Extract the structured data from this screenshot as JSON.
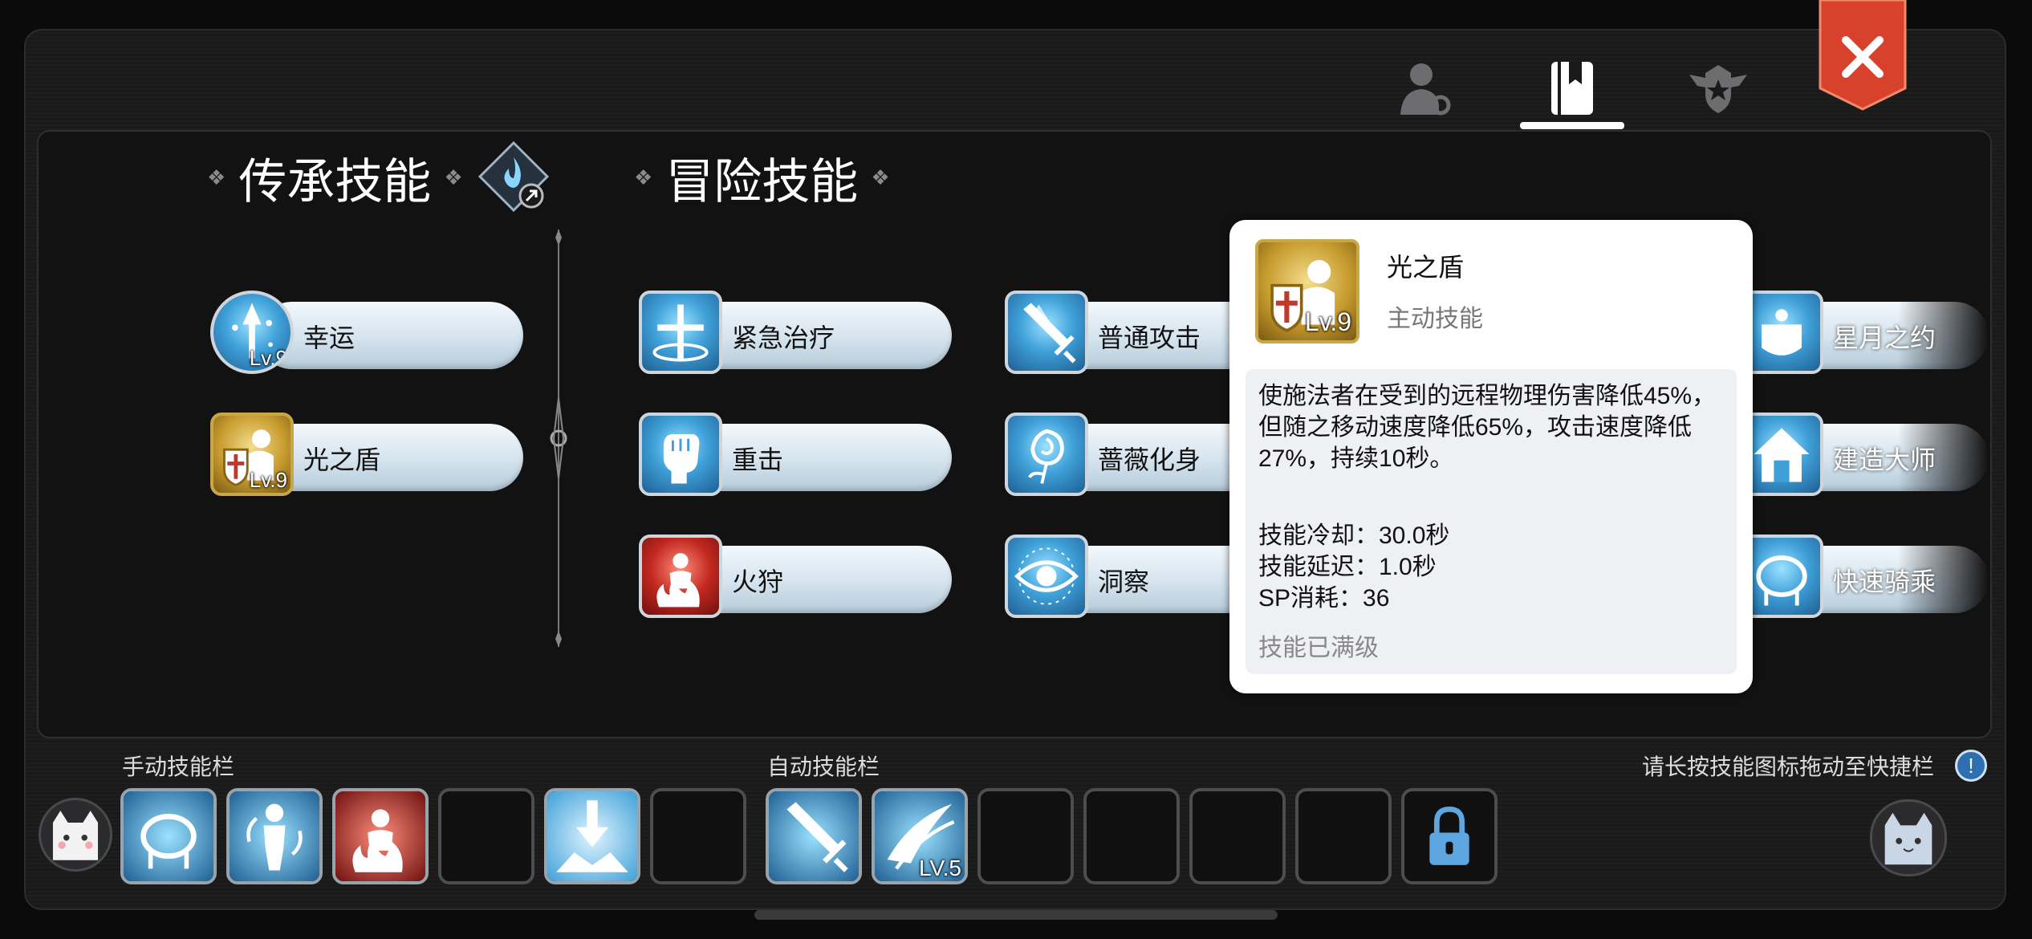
{
  "tabs": [
    {
      "name": "character-tab",
      "icon": "person-icon"
    },
    {
      "name": "skills-tab",
      "icon": "book-icon",
      "active": true
    },
    {
      "name": "guild-tab",
      "icon": "crest-icon"
    }
  ],
  "close_icon": "close-icon",
  "legacy": {
    "title": "传承技能",
    "skills": [
      {
        "label": "幸运",
        "level": "Lv.9",
        "icon": "luck-icon"
      },
      {
        "label": "光之盾",
        "level": "Lv.9",
        "icon": "light-shield-icon"
      }
    ]
  },
  "adventure": {
    "title": "冒险技能",
    "col1": [
      {
        "label": "紧急治疗",
        "icon": "cross-icon"
      },
      {
        "label": "重击",
        "icon": "fist-icon"
      },
      {
        "label": "火狩",
        "icon": "fire-icon"
      }
    ],
    "col2": [
      {
        "label": "普通攻击",
        "icon": "sword-icon"
      },
      {
        "label": "蔷薇化身",
        "icon": "rose-icon"
      },
      {
        "label": "洞察",
        "icon": "eye-icon"
      }
    ],
    "col3": [
      {
        "label": "星月之约",
        "icon": "star-moon-icon"
      },
      {
        "label": "建造大师",
        "icon": "house-icon"
      },
      {
        "label": "快速骑乘",
        "icon": "saddle-icon"
      }
    ]
  },
  "tooltip": {
    "name": "光之盾",
    "level": "Lv.9",
    "type": "主动技能",
    "description": "使施法者在受到的远程物理伤害降低45%，但随之移动速度降低65%，攻击速度降低27%，持续10秒。",
    "cooldown": "技能冷却：30.0秒",
    "delay": "技能延迟：1.0秒",
    "sp": "SP消耗：36",
    "max": "技能已满级"
  },
  "bars": {
    "manual_label": "手动技能栏",
    "auto_label": "自动技能栏",
    "hint": "请长按技能图标拖动至快捷栏",
    "hint_icon": "!",
    "auto_level": "LV.5"
  },
  "colors": {
    "accent_red": "#d8412b",
    "skill_blue": "#3fa0d8",
    "gold": "#c79b2e"
  }
}
